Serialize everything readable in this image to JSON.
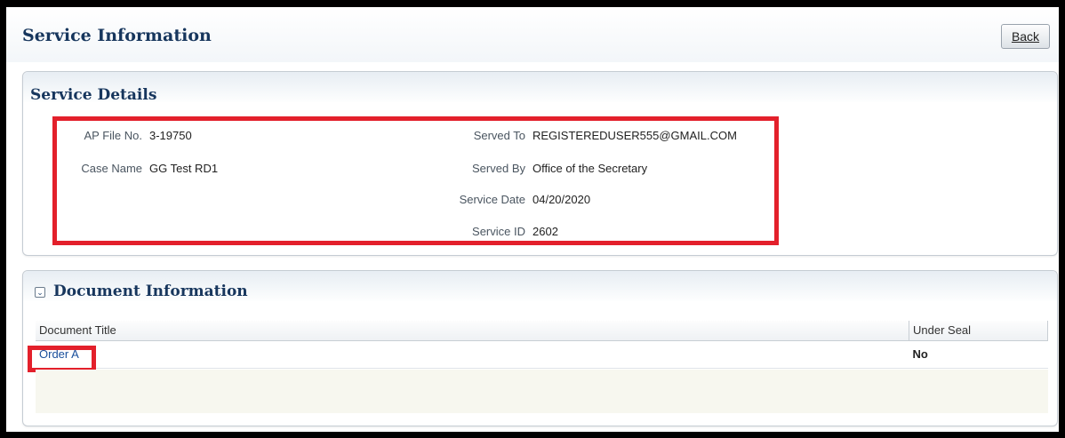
{
  "page": {
    "title": "Service Information",
    "back_label": "Back"
  },
  "service_details": {
    "title": "Service Details",
    "left": [
      {
        "label": "AP File No.",
        "value": "3-19750"
      },
      {
        "label": "Case Name",
        "value": "GG Test RD1"
      }
    ],
    "right": [
      {
        "label": "Served To",
        "value": "REGISTEREDUSER555@GMAIL.COM"
      },
      {
        "label": "Served By",
        "value": "Office of the Secretary"
      },
      {
        "label": "Service Date",
        "value": "04/20/2020"
      },
      {
        "label": "Service ID",
        "value": "2602"
      }
    ]
  },
  "document_information": {
    "title": "Document Information",
    "columns": [
      "Document Title",
      "Under Seal"
    ],
    "rows": [
      {
        "title": "Order A",
        "under_seal": "No"
      }
    ]
  },
  "colors": {
    "highlight": "#e3202b",
    "heading": "#17365d",
    "link": "#1a4f9c"
  }
}
